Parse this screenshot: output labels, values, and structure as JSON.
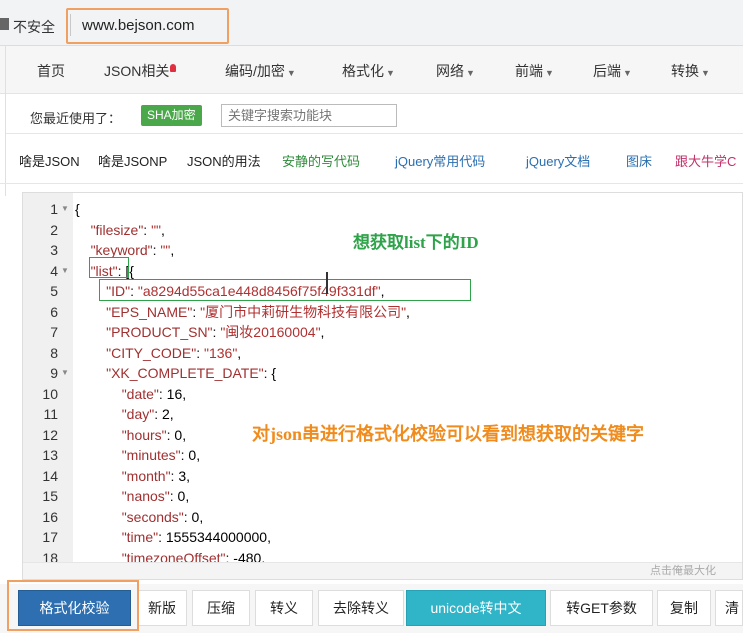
{
  "browser": {
    "security_label": "不安全",
    "url": "www.bejson.com"
  },
  "nav": {
    "items": [
      "首页",
      "JSON相关",
      "编码/加密",
      "格式化",
      "网络",
      "前端",
      "后端",
      "转换"
    ]
  },
  "recent": {
    "label": "您最近使用了：",
    "badge": "SHA加密",
    "search_placeholder": "关键字搜索功能块"
  },
  "quick_links": [
    {
      "text": "啥是JSON",
      "color": "#222222"
    },
    {
      "text": "啥是JSONP",
      "color": "#222222"
    },
    {
      "text": "JSON的用法",
      "color": "#222222"
    },
    {
      "text": "安静的写代码",
      "color": "#2e8b3a"
    },
    {
      "text": "jQuery常用代码",
      "color": "#2a6fb0"
    },
    {
      "text": "jQuery文档",
      "color": "#2a6fb0"
    },
    {
      "text": "图床",
      "color": "#2a6fb0"
    },
    {
      "text": "跟大牛学C",
      "color": "#c0306a"
    }
  ],
  "editor": {
    "lines": [
      {
        "num": "1",
        "fold": true,
        "code": "{"
      },
      {
        "num": "2",
        "fold": false,
        "code": "    \"filesize\": \"\","
      },
      {
        "num": "3",
        "fold": false,
        "code": "    \"keyword\": \"\","
      },
      {
        "num": "4",
        "fold": true,
        "code": "    \"list\": [{"
      },
      {
        "num": "5",
        "fold": false,
        "code": "        \"ID\": \"a8294d55ca1e448d8456f75f49f331df\","
      },
      {
        "num": "6",
        "fold": false,
        "code": "        \"EPS_NAME\": \"厦门市中莉研生物科技有限公司\","
      },
      {
        "num": "7",
        "fold": false,
        "code": "        \"PRODUCT_SN\": \"闽妆20160004\","
      },
      {
        "num": "8",
        "fold": false,
        "code": "        \"CITY_CODE\": \"136\","
      },
      {
        "num": "9",
        "fold": true,
        "code": "        \"XK_COMPLETE_DATE\": {"
      },
      {
        "num": "10",
        "fold": false,
        "code": "            \"date\": 16,"
      },
      {
        "num": "11",
        "fold": false,
        "code": "            \"day\": 2,"
      },
      {
        "num": "12",
        "fold": false,
        "code": "            \"hours\": 0,"
      },
      {
        "num": "13",
        "fold": false,
        "code": "            \"minutes\": 0,"
      },
      {
        "num": "14",
        "fold": false,
        "code": "            \"month\": 3,"
      },
      {
        "num": "15",
        "fold": false,
        "code": "            \"nanos\": 0,"
      },
      {
        "num": "16",
        "fold": false,
        "code": "            \"seconds\": 0,"
      },
      {
        "num": "17",
        "fold": false,
        "code": "            \"time\": 1555344000000,"
      },
      {
        "num": "18",
        "fold": false,
        "code": "            \"timezoneOffset\": -480,"
      }
    ],
    "maximize_hint": "点击俺最大化"
  },
  "annotations": {
    "get_id": "想获取list下的ID",
    "format_check": "对json串进行格式化校验可以看到想获取的关键字"
  },
  "toolbar": {
    "buttons": [
      "格式化校验",
      "新版",
      "压缩",
      "转义",
      "去除转义",
      "unicode转中文",
      "转GET参数",
      "复制",
      "清"
    ]
  },
  "colors": {
    "primary_button": "#2d6fb0",
    "teal_button": "#2fb4c8",
    "annotation_green": "#2ea34a",
    "annotation_orange": "#f08c1e",
    "highlight_outline": "#f0a060"
  }
}
